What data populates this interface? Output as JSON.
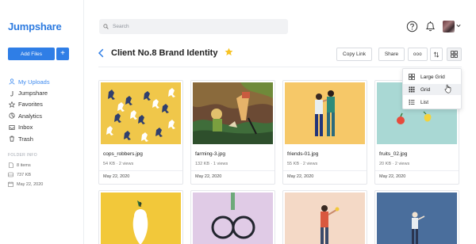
{
  "app": {
    "logo": "Jumpshare"
  },
  "sidebar": {
    "add_files_label": "Add Files",
    "add_plus_label": "+",
    "nav": [
      {
        "label": "My Uploads",
        "icon": "user-icon",
        "active": true
      },
      {
        "label": "Jumpshare",
        "icon": "jumpshare-icon",
        "active": false
      },
      {
        "label": "Favorites",
        "icon": "star-icon",
        "active": false
      },
      {
        "label": "Analytics",
        "icon": "analytics-icon",
        "active": false
      },
      {
        "label": "Inbox",
        "icon": "inbox-icon",
        "active": false
      },
      {
        "label": "Trash",
        "icon": "trash-icon",
        "active": false
      }
    ],
    "folder_info": {
      "title": "FOLDER INFO",
      "items_count": "8 items",
      "size": "737 KB",
      "date": "May 22, 2020"
    }
  },
  "topbar": {
    "search_placeholder": "Search"
  },
  "folder": {
    "title": "Client No.8 Brand Identity",
    "copy_link_label": "Copy Link",
    "share_label": "Share",
    "more_label": "ooo"
  },
  "view_menu": {
    "options": [
      {
        "label": "Large Grid",
        "icon": "large-grid-icon"
      },
      {
        "label": "Grid",
        "icon": "grid-icon"
      },
      {
        "label": "List",
        "icon": "list-icon"
      }
    ],
    "hovered": "Grid"
  },
  "files": [
    {
      "name": "cops_robbers.jpg",
      "meta": "54 KB · 2 views",
      "date": "May 22, 2020"
    },
    {
      "name": "farming-3.jpg",
      "meta": "132 KB · 1 views",
      "date": "May 22, 2020"
    },
    {
      "name": "friends-01.jpg",
      "meta": "55 KB · 2 views",
      "date": "May 22, 2020"
    },
    {
      "name": "fruits_02.jpg",
      "meta": "20 KB · 2 views",
      "date": "May 22, 2020"
    }
  ],
  "colors": {
    "brand_blue": "#2d7be0",
    "active_nav": "#3d8af0",
    "star_yellow": "#f7c325"
  }
}
